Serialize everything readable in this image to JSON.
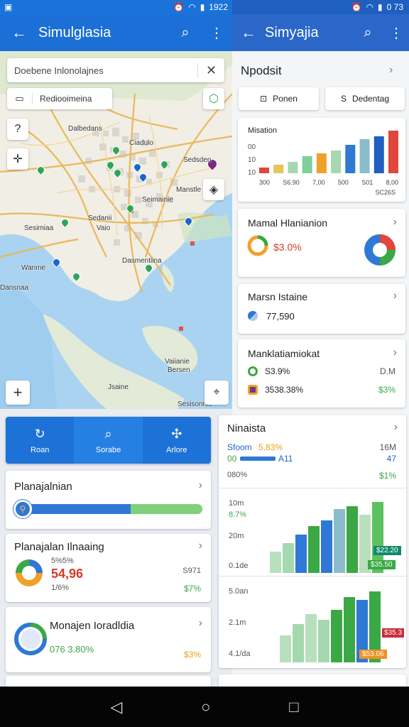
{
  "status": {
    "left_time": "1922",
    "right_time": "0 73"
  },
  "left_app": {
    "title": "Simulglasia"
  },
  "right_app": {
    "title": "Simyajia"
  },
  "map": {
    "search_value": "Doebene Inlonolajnes",
    "chip_label": "Rediooimeina",
    "labels": [
      "Dalbedans",
      "Ciadulo",
      "Manstle",
      "Sedanii",
      "Wanme",
      "Sedsden",
      "Sesimiaa",
      "Dasmentiina",
      "Vaiianie",
      "Bersen",
      "Jsaine",
      "Sesisonnie",
      "Dansnaa",
      "Seimainie",
      "Vaio"
    ]
  },
  "actions": [
    {
      "label": "Roan",
      "icon": "refresh-icon"
    },
    {
      "label": "Sorabe",
      "icon": "search-bug-icon"
    },
    {
      "label": "Arlore",
      "icon": "fan-icon"
    }
  ],
  "progress_card": {
    "title": "Planajalnian",
    "value": 0.62
  },
  "pie_card": {
    "title": "Planajalan Ilnaaing",
    "line1": "5%5%",
    "value_big": "54,96",
    "sub_left": "1/6%",
    "right_top": "S971",
    "right_bottom": "$7%"
  },
  "donut_card": {
    "title": "Monajen Ioradldia",
    "value": "076 3.80%",
    "right": "$3%"
  },
  "nposit": {
    "title": "Npodsit",
    "btn1": "Ponen",
    "btn2": "Dedentag"
  },
  "bar_card": {
    "title": "Misation",
    "y_ticks": [
      "00",
      "10",
      "10"
    ],
    "x_ticks": [
      "300",
      "S6.90",
      "7,00",
      "500",
      "S01",
      "8,00"
    ],
    "x_sub": "SC26S"
  },
  "mama_card": {
    "title": "Mamal Hlanianion",
    "value": "$3.0%"
  },
  "marsn_card": {
    "title": "Marsn Istaine",
    "value": "77,590"
  },
  "mankai_card": {
    "title": "Manklatiamiokat",
    "row1_left": "S3.9%",
    "row1_right": "D.M",
    "row2_left": "3538.38%",
    "row2_right": "$3%"
  },
  "ninaista": {
    "title": "Ninaista",
    "stat_label": "Sfoom",
    "stat_pct": "5,83%",
    "stat_right": "16M",
    "row2_left": "00",
    "row2_mid": "A11",
    "row2_right": "47",
    "row3_left": "080%",
    "row3_right": "$1%",
    "chart1_y": [
      "10m",
      "8.7%",
      "20m",
      "0.1de"
    ],
    "chart1_badge1": "$22.20",
    "chart1_badge2": "$35.50",
    "chart2_y": [
      "5.0an",
      "2.1m",
      "4.1/da"
    ],
    "chart2_badge1": "$35.3",
    "chart2_badge2": "$53.06"
  },
  "chart_data": {
    "type": "bar",
    "title": "Misation",
    "categories": [
      "300",
      "S6.90",
      "7,00",
      "500",
      "S01",
      "8,00"
    ],
    "series": [
      {
        "values": [
          2,
          3,
          4,
          6,
          7,
          8,
          10,
          12,
          13,
          15
        ]
      }
    ]
  },
  "colors": {
    "primary": "#1c6fd6",
    "green": "#3aa845",
    "red": "#d73a24",
    "orange": "#f0a12a"
  }
}
